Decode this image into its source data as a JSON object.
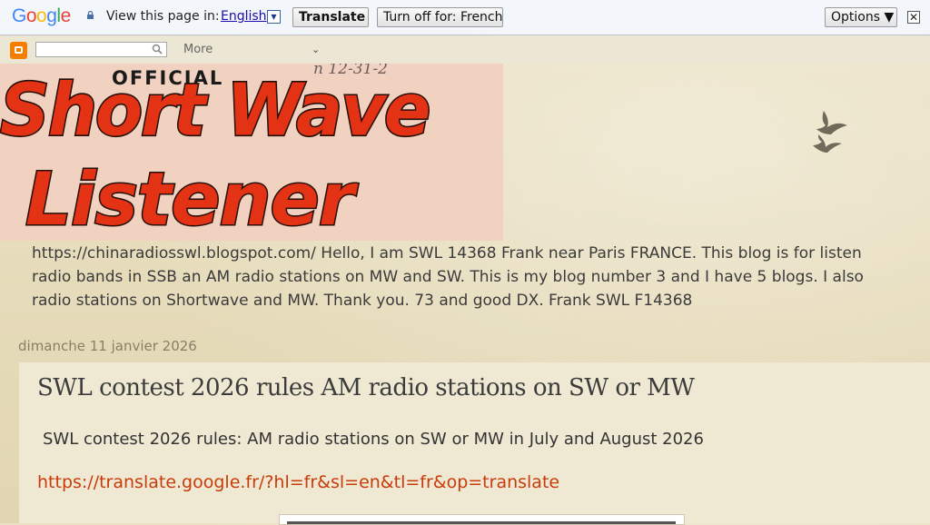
{
  "translate_bar": {
    "logo": "Google",
    "prompt": "View this page in:",
    "language": "English",
    "translate_button": "Translate",
    "turn_off_button": "Turn off for: French",
    "options_button": "Options ▼",
    "close": "✕"
  },
  "navbar": {
    "search_value": "",
    "more_label": "More"
  },
  "header": {
    "banner_official": "OFFICIAL",
    "banner_line1": "Short Wave",
    "banner_line2": "Listener",
    "banner_handwriting": "n 12-31-2",
    "description": [
      "https://chinaradiosswl.blogspot.com/ Hello, I am SWL 14368 Frank near Paris FRANCE. This blog is for listen",
      "radio bands in SSB an AM radio stations on MW and SW. This is my blog number 3 and I have 5 blogs. I also",
      "radio stations on Shortwave and MW. Thank you. 73 and good DX. Frank SWL F14368"
    ]
  },
  "post": {
    "date": "dimanche 11 janvier 2026",
    "title": "SWL contest 2026 rules AM radio stations on SW or MW",
    "subtitle": "SWL contest 2026 rules: AM radio stations on SW or MW in July and August 2026",
    "link": "https://translate.google.fr/?hl=fr&sl=en&tl=fr&op=translate"
  },
  "colors": {
    "accent_link": "#c83b0a",
    "banner_red": "#e33214",
    "translate_link": "#1a0dab"
  }
}
